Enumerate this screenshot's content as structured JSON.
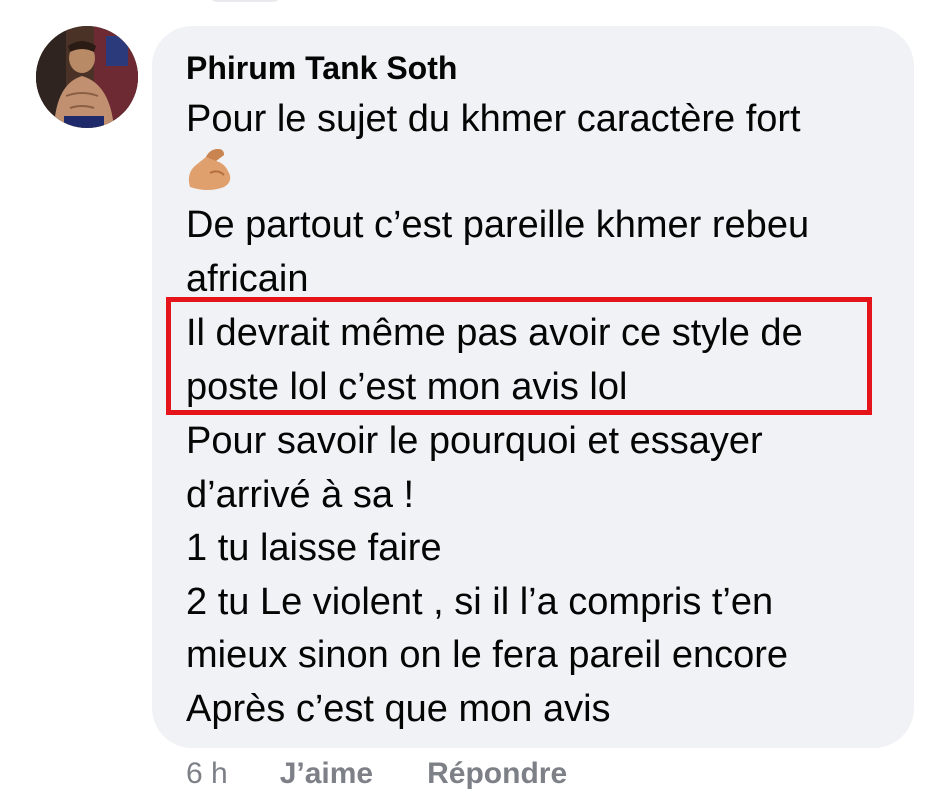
{
  "comment": {
    "author": "Phirum Tank Soth",
    "lines": [
      "Pour le sujet du khmer caractère fort",
      "De partout c’est pareille khmer rebeu",
      "africain",
      "Il devrait même pas avoir ce style de",
      "poste lol c’est mon avis lol",
      "Pour savoir le pourquoi et essayer",
      "d’arrivé à sa !",
      "1 tu laisse faire",
      "2 tu Le violent , si il l’a compris t’en",
      "mieux sinon on le fera pareil encore",
      "Après c’est que mon avis"
    ],
    "emoji": "flexed-biceps-icon"
  },
  "actions": {
    "time": "6 h",
    "like_label": "J’aime",
    "reply_label": "Répondre"
  },
  "colors": {
    "bubble": "#f0f2f5",
    "text": "#050505",
    "meta": "#7d8087",
    "highlight": "#e5141b"
  }
}
